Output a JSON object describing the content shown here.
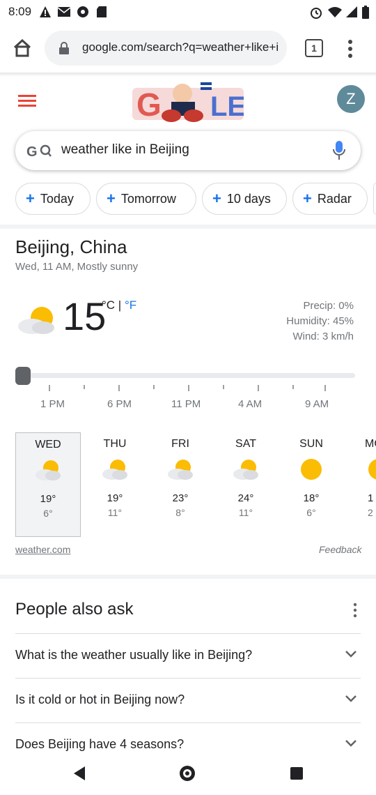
{
  "status_bar": {
    "time": "8:09"
  },
  "browser": {
    "url": "google.com/search?q=weather+like+i",
    "tab_count": "1"
  },
  "google": {
    "avatar_letter": "Z"
  },
  "search": {
    "query": "weather like in Beijing"
  },
  "chips": [
    {
      "label": "Today"
    },
    {
      "label": "Tomorrow"
    },
    {
      "label": "10 days"
    },
    {
      "label": "Radar"
    }
  ],
  "weather": {
    "location": "Beijing, China",
    "subtitle": "Wed, 11 AM, Mostly sunny",
    "temperature": "15",
    "unit_c": "°C",
    "unit_sep": " | ",
    "unit_f": "°F",
    "precip": "Precip: 0%",
    "humidity": "Humidity: 45%",
    "wind": "Wind: 3 km/h",
    "hours": [
      "1 PM",
      "6 PM",
      "11 PM",
      "4 AM",
      "9 AM"
    ],
    "days": [
      {
        "name": "WED",
        "hi": "19°",
        "lo": "6°",
        "icon": "partly-sunny-icon"
      },
      {
        "name": "THU",
        "hi": "19°",
        "lo": "11°",
        "icon": "partly-sunny-icon"
      },
      {
        "name": "FRI",
        "hi": "23°",
        "lo": "8°",
        "icon": "partly-sunny-icon"
      },
      {
        "name": "SAT",
        "hi": "24°",
        "lo": "11°",
        "icon": "partly-sunny-icon"
      },
      {
        "name": "SUN",
        "hi": "18°",
        "lo": "6°",
        "icon": "sunny-icon"
      },
      {
        "name": "MO",
        "hi": "1",
        "lo": "2",
        "icon": "sunny-icon"
      }
    ],
    "source": "weather.com",
    "feedback": "Feedback"
  },
  "paa": {
    "title": "People also ask",
    "questions": [
      "What is the weather usually like in Beijing?",
      "Is it cold or hot in Beijing now?",
      "Does Beijing have 4 seasons?"
    ]
  },
  "colors": {
    "accent": "#1a73e8",
    "sun": "#fbbc04"
  }
}
